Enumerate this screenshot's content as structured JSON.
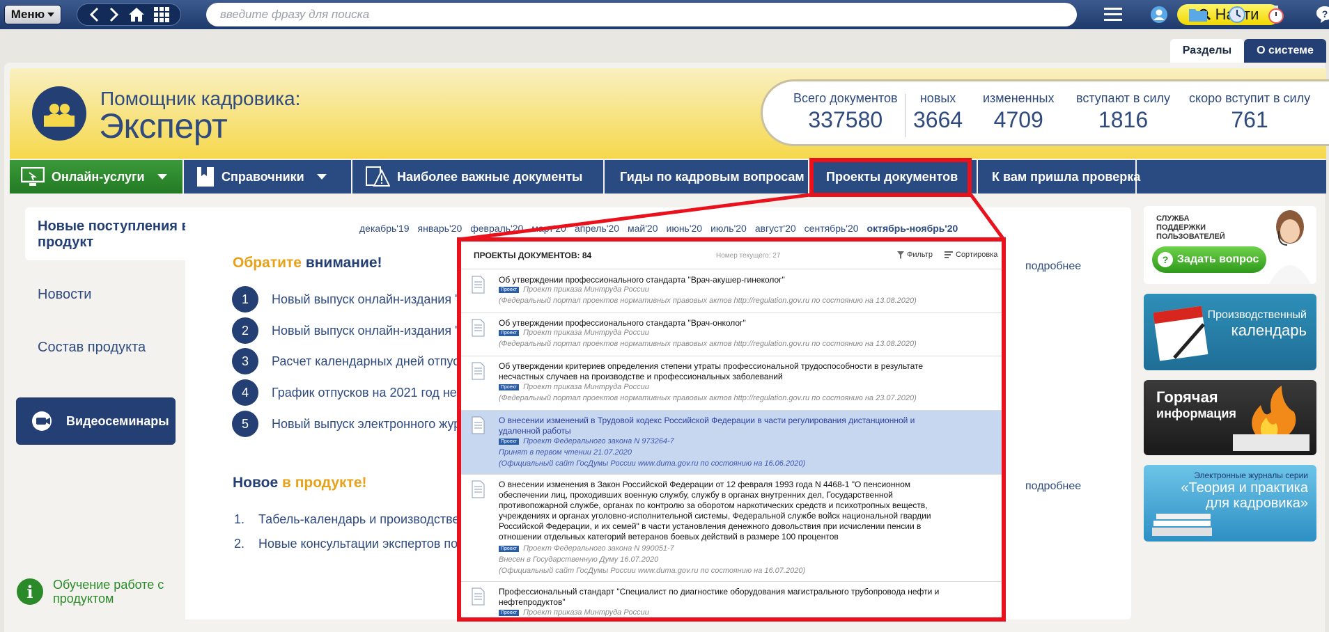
{
  "topbar": {
    "menu_label": "Меню",
    "search_placeholder": "введите фразу для поиска",
    "find_label": "Найти"
  },
  "tabs": {
    "razdely": "Разделы",
    "o_sisteme": "О системе"
  },
  "brand": {
    "top": "Помощник кадровика:",
    "main": "Эксперт"
  },
  "stats": [
    {
      "label": "Всего документов",
      "value": "337580"
    },
    {
      "label": "новых",
      "value": "3664"
    },
    {
      "label": "измененных",
      "value": "4709"
    },
    {
      "label": "вступают в силу",
      "value": "1816"
    },
    {
      "label": "скоро вступит в силу",
      "value": "761"
    }
  ],
  "nav": [
    "Онлайн-услуги",
    "Справочники",
    "Наиболее важные документы",
    "Гиды по кадровым вопросам",
    "Проекты документов",
    "К вам пришла проверка"
  ],
  "left": {
    "active": "Новые поступления в продукт",
    "items": [
      "Новости",
      "Состав продукта"
    ],
    "video": "Видеосеминары",
    "learn": "Обучение работе с продуктом"
  },
  "months": [
    "декабрь'19",
    "январь'20",
    "февраль'20",
    "март'20",
    "апрель'20",
    "май'20",
    "июнь'20",
    "июль'20",
    "август'20",
    "сентябрь'20",
    "октябрь-ноябрь'20"
  ],
  "attention": {
    "title_a": "Обратите",
    "title_b": "внимание!",
    "more": "подробнее",
    "items": [
      "Новый выпуск онлайн-издания \"",
      "Новый выпуск онлайн-издания \"",
      "Расчет календарных дней отпус",
      "График отпусков на 2021 год не",
      "Новый выпуск электронного жур"
    ]
  },
  "new_in_product": {
    "title_a": "Новое",
    "title_b": "в продукте!",
    "more": "подробнее",
    "items": [
      "Табель-календарь и производстве",
      "Новые консультации экспертов по"
    ]
  },
  "popup": {
    "title": "ПРОЕКТЫ ДОКУМЕНТОВ: 84",
    "current": "Номер текущего: 27",
    "filter": "Фильтр",
    "sort": "Сортировка",
    "badge": "Проект",
    "docs": [
      {
        "title": "Об утверждении профессионального стандарта \"Врач-акушер-гинеколог\"",
        "type": "Проект приказа Минтруда России",
        "lines": [
          "(Федеральный портал проектов нормативных правовых актов http://regulation.gov.ru по состоянию на 13.08.2020)"
        ]
      },
      {
        "title": "Об утверждении профессионального стандарта \"Врач-онколог\"",
        "type": "Проект приказа Минтруда России",
        "lines": [
          "(Федеральный портал проектов нормативных правовых актов http://regulation.gov.ru по состоянию на 13.08.2020)"
        ]
      },
      {
        "title": "Об утверждении критериев определения степени утраты профессиональной трудоспособности в результате несчастных случаев на производстве и профессиональных заболеваний",
        "type": "Проект приказа Минтруда России",
        "lines": [
          "(Федеральный портал проектов нормативных правовых актов http://regulation.gov.ru по состоянию на 23.07.2020)"
        ]
      },
      {
        "title": "О внесении изменений в Трудовой кодекс Российской Федерации в части регулирования дистанционной и удаленной работы",
        "type": "Проект Федерального закона N 973264-7",
        "lines": [
          "Принят в первом чтении 21.07.2020",
          "(Официальный сайт ГосДумы России www.duma.gov.ru по состоянию на 16.06.2020)"
        ]
      },
      {
        "title": "О внесении изменения в Закон Российской Федерации от 12 февраля 1993 года N 4468-1 \"О пенсионном обеспечении лиц, проходивших военную службу, службу в органах внутренних дел, Государственной противопожарной службе, органах по контролю за оборотом наркотических средств и психотропных веществ, учреждениях и органах уголовно-исполнительной системы, Федеральной службе войск национальной гвардии Российской Федерации, и их семей\" в части установления денежного довольствия при исчислении пенсии в отношении отдельных категорий ветеранов боевых действий в размере 100 процентов",
        "type": "Проект Федерального закона N 990051-7",
        "lines": [
          "Внесен в Государственную Думу 16.07.2020",
          "(Официальный сайт ГосДумы России www.duma.gov.ru по состоянию на 16.07.2020)"
        ]
      },
      {
        "title": "Профессиональный стандарт \"Специалист по диагностике оборудования магистрального трубопровода нефти и нефтепродуктов\"",
        "type": "Проект приказа Минтруда России",
        "lines": []
      }
    ]
  },
  "right": {
    "support": "СЛУЖБА ПОДДЕРЖКИ ПОЛЬЗОВАТЕЛЕЙ",
    "ask": "Задать вопрос",
    "calendar_a": "Производственный",
    "calendar_b": "календарь",
    "hot_a": "Горячая",
    "hot_b": "информация",
    "journals_a": "Электронные журналы серии",
    "journals_b": "«Теория и практика для кадровика»"
  },
  "colors": {
    "brand_blue": "#233f74",
    "accent_yellow": "#f6d84c",
    "highlight_red": "#e8111c",
    "green": "#2e9a1a"
  }
}
